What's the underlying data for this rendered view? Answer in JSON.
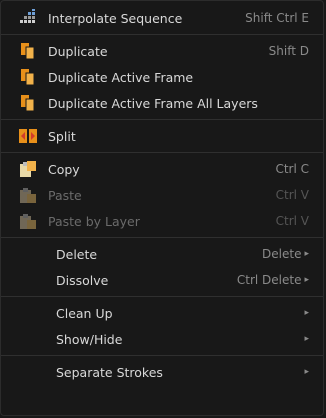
{
  "menu": {
    "items": [
      {
        "label": "Interpolate Sequence",
        "shortcut": "Shift Ctrl E",
        "icon": "interpolate-icon"
      },
      {
        "label": "Duplicate",
        "shortcut": "Shift D",
        "icon": "duplicate-icon"
      },
      {
        "label": "Duplicate Active Frame",
        "shortcut": "",
        "icon": "duplicate-icon"
      },
      {
        "label": "Duplicate Active Frame All Layers",
        "shortcut": "",
        "icon": "duplicate-icon"
      },
      {
        "label": "Split",
        "shortcut": "",
        "icon": "split-icon"
      },
      {
        "label": "Copy",
        "shortcut": "Ctrl C",
        "icon": "copy-icon"
      },
      {
        "label": "Paste",
        "shortcut": "Ctrl V",
        "icon": "paste-icon",
        "disabled": true
      },
      {
        "label": "Paste by Layer",
        "shortcut": "Ctrl V",
        "icon": "paste-icon",
        "disabled": true
      },
      {
        "label": "Delete",
        "shortcut": "Delete",
        "submenu": true
      },
      {
        "label": "Dissolve",
        "shortcut": "Ctrl Delete",
        "submenu": true
      },
      {
        "label": "Clean Up",
        "shortcut": "",
        "submenu": true
      },
      {
        "label": "Show/Hide",
        "shortcut": "",
        "submenu": true
      },
      {
        "label": "Separate Strokes",
        "shortcut": "",
        "submenu": true
      }
    ],
    "submenu_arrow": "▸"
  },
  "colors": {
    "background": "#181818",
    "text": "#d9d9d9",
    "disabled_text": "#6b6b6b",
    "shortcut_text": "#8a8a8a",
    "icon_orange": "#e8901a",
    "icon_red": "#d43b2b"
  }
}
